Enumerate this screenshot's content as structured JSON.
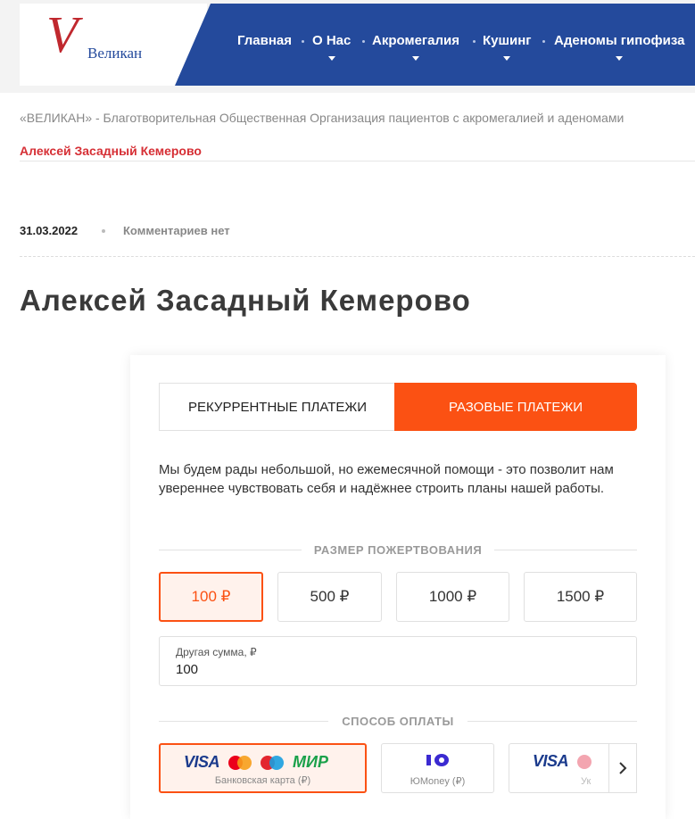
{
  "header": {
    "logo_letter": "V",
    "logo_text": "Великан",
    "nav": [
      {
        "label": "Главная",
        "has_dropdown": false
      },
      {
        "label": "О Нас",
        "has_dropdown": true
      },
      {
        "label": "Акромегалия",
        "has_dropdown": true
      },
      {
        "label": "Кушинг",
        "has_dropdown": true
      },
      {
        "label": "Аденомы гипофиза",
        "has_dropdown": true
      }
    ]
  },
  "breadcrumb": {
    "root": "«ВЕЛИКАН» - Благотворительная Общественная Организация пациентов с акромегалией и аденомами",
    "current": "Алексей Засадный Кемерово"
  },
  "post": {
    "date": "31.03.2022",
    "comments": "Комментариев нет",
    "title": "Алексей Засадный Кемерово"
  },
  "donation": {
    "tabs": {
      "recurring": "РЕКУРРЕНТНЫЕ ПЛАТЕЖИ",
      "one_time": "РАЗОВЫЕ ПЛАТЕЖИ",
      "active": "one_time"
    },
    "description": "Мы будем рады небольшой, но ежемесячной помощи - это позволит нам увереннее чувствовать себя и надёжнее строить планы нашей работы.",
    "amount_label": "РАЗМЕР ПОЖЕРТВОВАНИЯ",
    "amounts": [
      "100 ₽",
      "500 ₽",
      "1000 ₽",
      "1500 ₽"
    ],
    "selected_amount": "100 ₽",
    "custom_label": "Другая сумма, ₽",
    "custom_value": "100",
    "payment_label": "СПОСОБ ОПЛАТЫ",
    "payment_methods": [
      {
        "caption": "Банковская карта (₽)",
        "brands": [
          "VISA",
          "МИР"
        ]
      },
      {
        "caption": "ЮMoney (₽)",
        "brands": [
          "ЮMoney"
        ]
      },
      {
        "caption": "Ук",
        "brands": [
          "VISA"
        ]
      }
    ]
  },
  "colors": {
    "brand_blue": "#244a9c",
    "brand_red": "#d62f35",
    "accent_orange": "#fb5113"
  }
}
